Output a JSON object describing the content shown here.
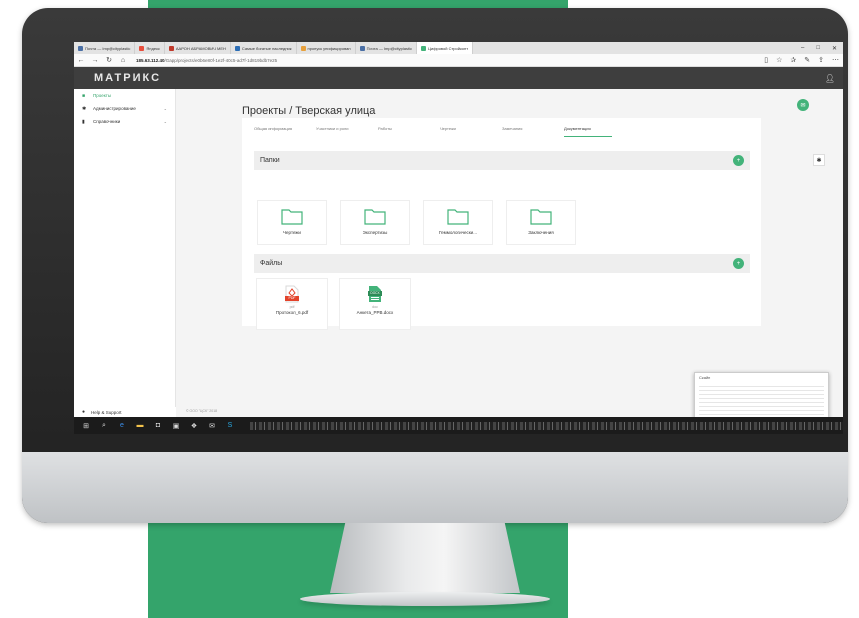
{
  "browser": {
    "tabs": [
      {
        "label": "Почта — Imp@cityplastic",
        "color": "#4a6fa5"
      },
      {
        "label": "Яндекс",
        "color": "#e84e3c"
      },
      {
        "label": "ААРОН АБРАМОВИЧ МЕН",
        "color": "#c0392b"
      },
      {
        "label": "Самые богатые наследник",
        "color": "#2b6db5"
      },
      {
        "label": "пропуск унифицирован",
        "color": "#e8a13c"
      },
      {
        "label": "Почта — Imp@cityplastic",
        "color": "#4a6fa5"
      },
      {
        "label": "Цифровой Стройконт",
        "color": "#43b37a"
      }
    ],
    "url_host": "185.63.112.40",
    "url_path": "/Gapp/projects/e0b6e80f-1e2f-40c5-ad7f-1d819bdb7e25"
  },
  "app": {
    "logo": "МАТРИКС"
  },
  "sidebar": {
    "items": [
      {
        "label": "Проекты",
        "icon": "home-icon"
      },
      {
        "label": "Администрирование",
        "icon": "gear-icon"
      },
      {
        "label": "Справочники",
        "icon": "book-icon"
      }
    ],
    "help": "Help & Support",
    "copyright": "© ООО \"ЦСК\" 2018"
  },
  "main": {
    "title": "Проекты / Тверская улица",
    "tabs": [
      "Общая информация",
      "Участники и роли",
      "Работы",
      "Чертежи",
      "Замечания",
      "Документация"
    ],
    "active_tab": "Документация",
    "folders_title": "Папки",
    "folders": [
      "Чертежи",
      "Экспертизы",
      "Геммологически...",
      "Заключения"
    ],
    "files_title": "Файлы",
    "files": [
      {
        "badge": "PDF",
        "ext": "pdf",
        "name": "Протокол_6.pdf"
      },
      {
        "badge": "DOCX",
        "ext": "doc",
        "name": "Анкета_РРВ.docx"
      }
    ]
  },
  "thumbnail": {
    "title": "Скайп"
  },
  "colors": {
    "accent": "#43b37a",
    "header": "#3e3e3e",
    "background_green": "#34a46b"
  }
}
